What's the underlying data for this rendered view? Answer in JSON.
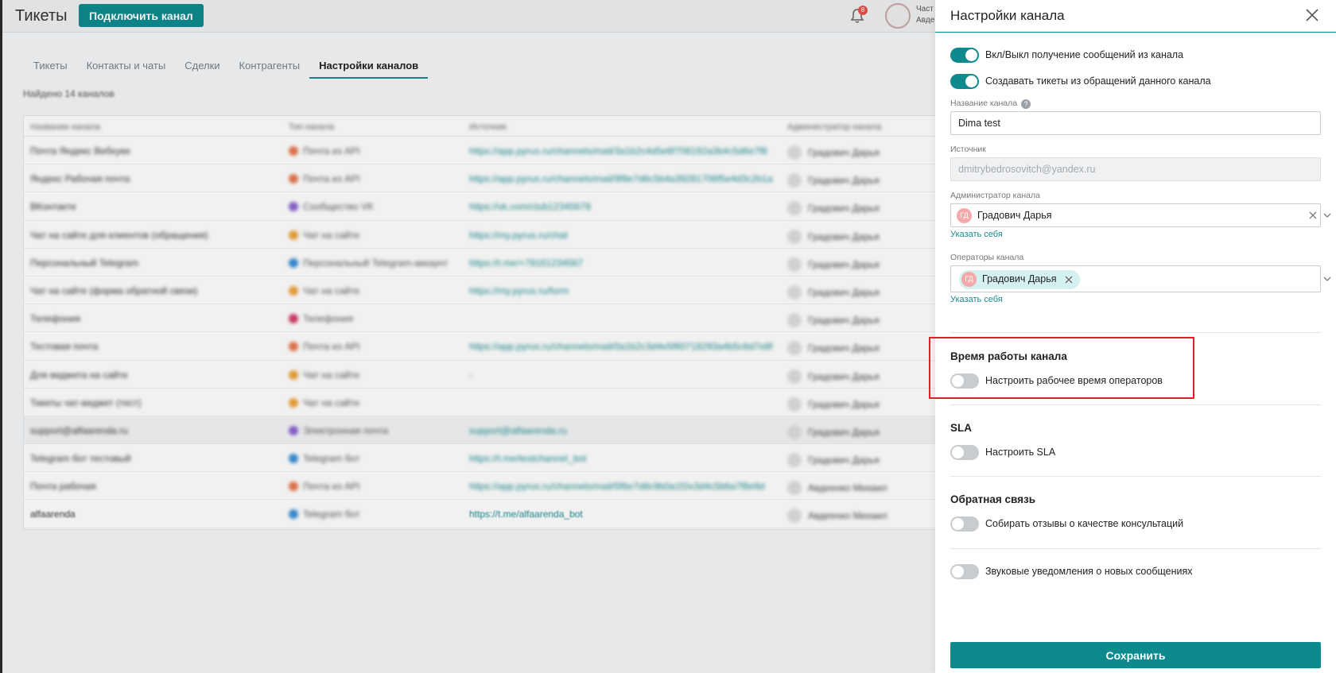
{
  "app": {
    "title": "Тикеты",
    "connect_button": "Подключить канал",
    "notifications_count": "8",
    "user_line_1": "Част",
    "user_line_2": "Авде"
  },
  "tabs": [
    {
      "label": "Тикеты",
      "active": false
    },
    {
      "label": "Контакты и чаты",
      "active": false
    },
    {
      "label": "Сделки",
      "active": false
    },
    {
      "label": "Контрагенты",
      "active": false
    },
    {
      "label": "Настройки каналов",
      "active": true
    }
  ],
  "found_text": "Найдено 14 каналов",
  "table": {
    "headers": [
      "Название канала",
      "Тип канала",
      "Источник",
      "Администратор канала"
    ],
    "rows": [
      {
        "name": "Почта Яндекс Вебхуки",
        "type": "Почта из API",
        "link": "https://app.pyrus.ru/channels/mail/3a1b2c4d5e6f708192a3b4c5d6e7f8",
        "admin": "Градович Дарья",
        "dot": "#e8774f"
      },
      {
        "name": "Яндекс Рабочая почта",
        "type": "Почта из API",
        "link": "https://app.pyrus.ru/channels/mail/9f8e7d6c5b4a39281706f5e4d3c2b1a",
        "admin": "Градович Дарья",
        "dot": "#e8774f"
      },
      {
        "name": "ВКонтакте",
        "type": "Сообщество VK",
        "link": "https://vk.com/club12345678",
        "admin": "Градович Дарья",
        "dot": "#8a63d2"
      },
      {
        "name": "Чат на сайте для клиентов (обращения)",
        "type": "Чат на сайте",
        "link": "https://my.pyrus.ru/chat",
        "admin": "Градович Дарья",
        "dot": "#f0a33c"
      },
      {
        "name": "Персональный Telegram",
        "type": "Персональный Telegram-аккаунт",
        "link": "https://t.me/+79161234567",
        "admin": "Градович Дарья",
        "dot": "#3b8fd9"
      },
      {
        "name": "Чат на сайте (форма обратной связи)",
        "type": "Чат на сайте",
        "link": "https://my.pyrus.ru/form",
        "admin": "Градович Дарья",
        "dot": "#f0a33c"
      },
      {
        "name": "Телефония",
        "type": "Телефония",
        "link": "",
        "admin": "Градович Дарья",
        "dot": "#d43c6a"
      },
      {
        "name": "Тестовая почта",
        "type": "Почта из API",
        "link": "https://app.pyrus.ru/channels/mail/0a1b2c3d4e5f60718293a4b5c6d7e8f",
        "admin": "Градович Дарья",
        "dot": "#e8774f"
      },
      {
        "name": "Для виджета на сайте",
        "type": "Чат на сайте",
        "link": "-",
        "admin": "Градович Дарья",
        "dot": "#f0a33c"
      },
      {
        "name": "Тикеты чат-виджет (тест)",
        "type": "Чат на сайте",
        "link": "",
        "admin": "Градович Дарья",
        "dot": "#f0a33c"
      },
      {
        "name": "support@alfaarenda.ru",
        "type": "Электронная почта",
        "link": "support@alfaarenda.ru",
        "admin": "Градович Дарья",
        "dot": "#8a63d2"
      },
      {
        "name": "Telegram бот тестовый",
        "type": "Telegram бот",
        "link": "https://t.me/testchannel_bot",
        "admin": "Градович Дарья",
        "dot": "#3b8fd9"
      },
      {
        "name": "Почта рабочая",
        "type": "Почта из API",
        "link": "https://app.pyrus.ru/channels/mail/5f6e7d8c9b0a1f2e3d4c5b6a7f8e9d",
        "admin": "Авдеенко Михаил",
        "dot": "#e8774f"
      },
      {
        "name": "alfaarenda",
        "type": "Telegram бот",
        "link": "https://t.me/alfaarenda_bot",
        "admin": "Авдеенко Михаил",
        "dot": "#3b8fd9"
      }
    ]
  },
  "drawer": {
    "title": "Настройки канала",
    "toggle_receive": {
      "label": "Вкл/Выкл получение сообщений из канала",
      "on": true
    },
    "toggle_tickets": {
      "label": "Создавать тикеты из обращений данного канала",
      "on": true
    },
    "channel_name": {
      "label": "Название канала",
      "value": "Dima test"
    },
    "source": {
      "label": "Источник",
      "value": "dmitrybedrosovitch@yandex.ru"
    },
    "admin": {
      "label": "Администратор канала",
      "initials": "ГД",
      "value": "Градович Дарья",
      "link": "Указать себя"
    },
    "operators": {
      "label": "Операторы канала",
      "initials": "ГД",
      "chip": "Градович Дарья",
      "link": "Указать себя"
    },
    "work_time": {
      "title": "Время работы канала",
      "toggle_label": "Настроить рабочее время операторов",
      "on": false
    },
    "sla": {
      "title": "SLA",
      "toggle_label": "Настроить SLA",
      "on": false
    },
    "feedback": {
      "title": "Обратная связь",
      "toggle_label": "Собирать отзывы о качестве консультаций",
      "on": false
    },
    "sound": {
      "toggle_label": "Звуковые уведомления о новых сообщениях",
      "on": false
    },
    "save_button": "Сохранить"
  },
  "colors": {
    "accent": "#0e8a8f",
    "highlight": "#e01f26",
    "chip": "#d5f0f0",
    "avatar": "#f4a9a8"
  }
}
